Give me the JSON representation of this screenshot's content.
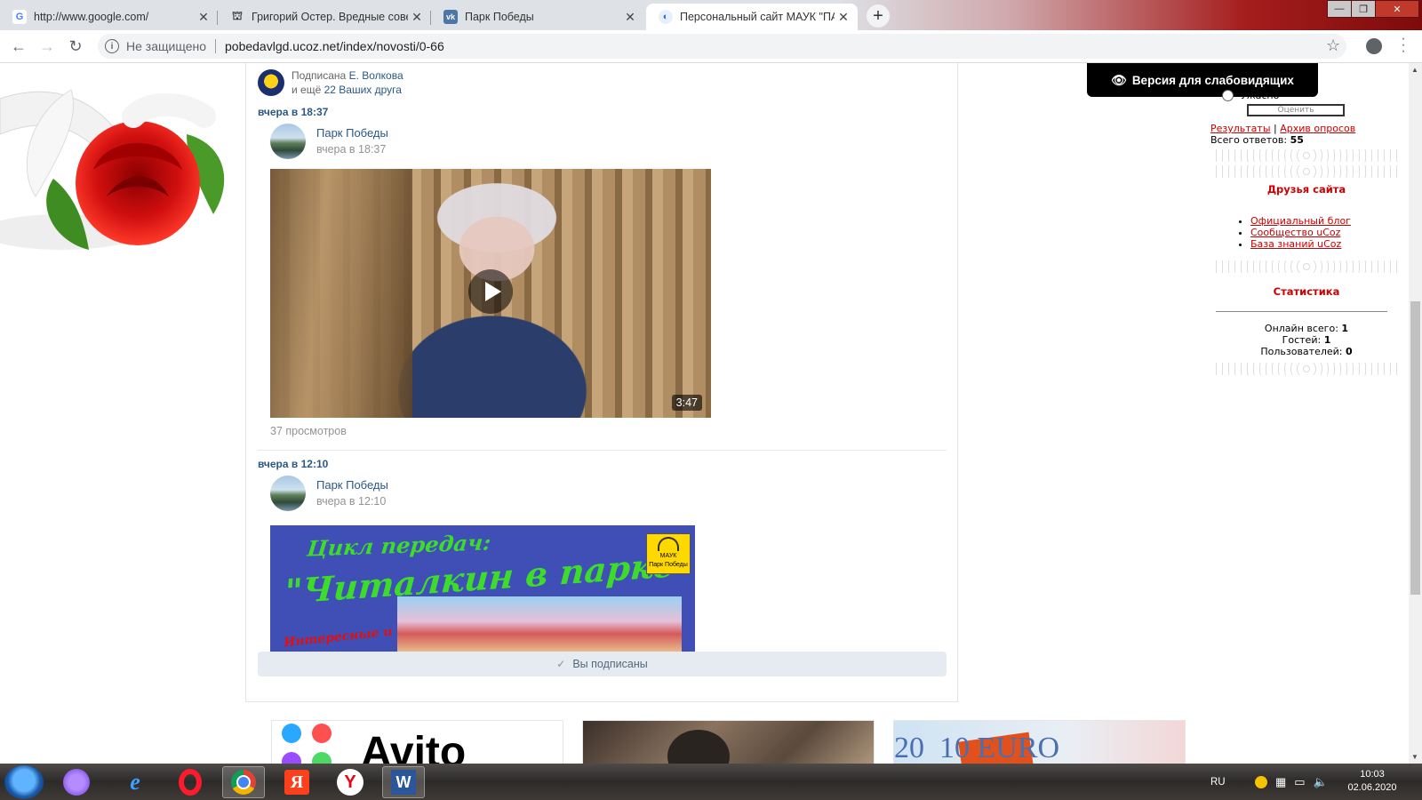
{
  "browser": {
    "tabs": [
      {
        "title": "http://www.google.com/",
        "icon": "google-g-icon"
      },
      {
        "title": "Григорий Остер. Вредные сове",
        "icon": "building-icon"
      },
      {
        "title": "Парк Победы",
        "icon": "vk-icon"
      },
      {
        "title": "Персональный сайт МАУК \"ПАР",
        "icon": "site-icon"
      }
    ],
    "window_controls": [
      "—",
      "❐",
      "✕"
    ],
    "security_label": "Не защищено",
    "url": "pobedavlgd.ucoz.net/index/novosti/0-66"
  },
  "vk_widget": {
    "subscribed_by_prefix": "Подписана",
    "subscribed_by_name": "Е. Волкова",
    "and_more_prefix": "и ещё",
    "friends_link": "22 Ваших друга",
    "posts": [
      {
        "timestamp": "вчера в 18:37",
        "author": "Парк Победы",
        "time": "вчера в 18:37",
        "video_duration": "3:47",
        "views": "37 просмотров"
      },
      {
        "timestamp": "вчера в 12:10",
        "author": "Парк Победы",
        "time": "вчера в 12:10",
        "poster_line1": "Цикл передач:",
        "poster_line2": "\"Читалкин в парке\"",
        "poster_line3": "Интересные и",
        "poster_badge_line1": "МАУК",
        "poster_badge_line2": "Парк Победы"
      }
    ],
    "subscribed_button": "Вы подписаны"
  },
  "ads": [
    {
      "label": "Avito"
    },
    {
      "label": ""
    },
    {
      "label": "20  10 EURO"
    }
  ],
  "sidebar": {
    "low_vision_button": "Версия для слабовидящих",
    "poll_option": "Ужасно",
    "rate_button": "Оценить",
    "results_link": "Результаты",
    "archive_link": "Архив опросов",
    "total_answers_label": "Всего ответов:",
    "total_answers_value": "55",
    "friends_title": "Друзья сайта",
    "friends_links": [
      "Официальный блог",
      "Сообщество uCoz",
      "База знаний uCoz"
    ],
    "stats_title": "Статистика",
    "online_label": "Онлайн всего:",
    "online_value": "1",
    "guests_label": "Гостей:",
    "guests_value": "1",
    "users_label": "Пользователей:",
    "users_value": "0"
  },
  "taskbar": {
    "apps": [
      "alice-icon",
      "ie-icon",
      "opera-icon",
      "chrome-icon",
      "yandex-icon",
      "yandex-browser-icon",
      "word-icon"
    ],
    "lang": "RU",
    "time": "10:03",
    "date": "02.06.2020"
  },
  "colors": {
    "vk_link": "#2a5885",
    "ucoz_red": "#cc0000",
    "tab_strip": "#dee1e6"
  }
}
